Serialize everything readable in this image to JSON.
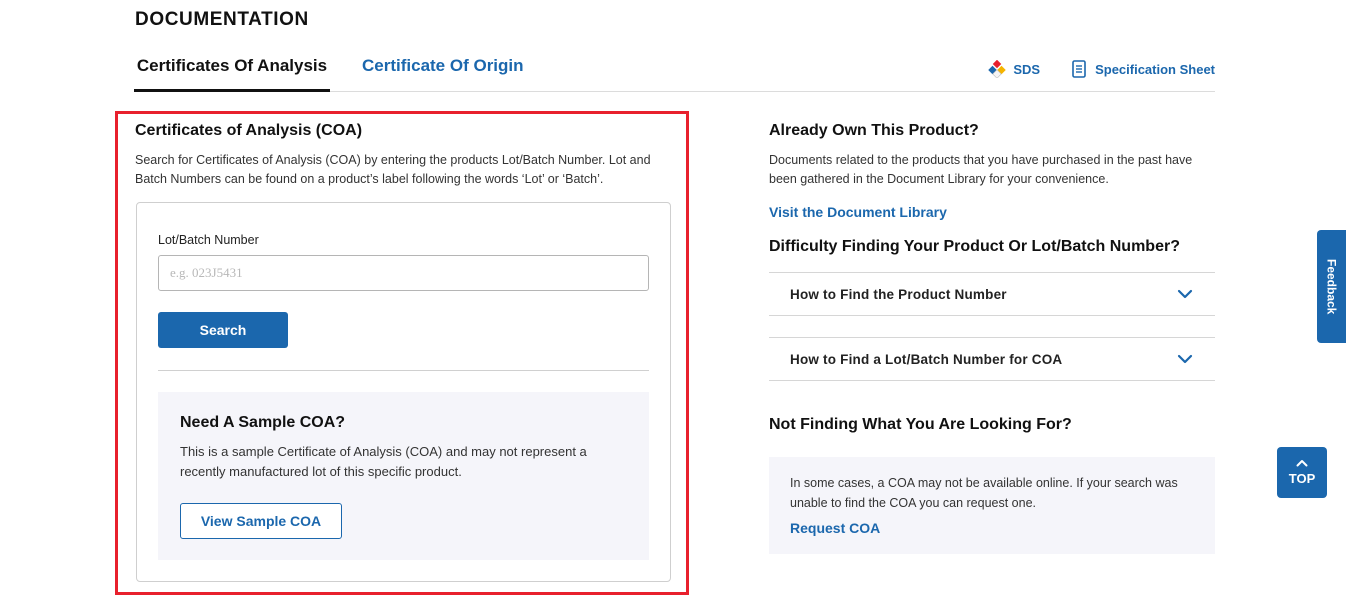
{
  "section": {
    "title": "DOCUMENTATION"
  },
  "tabs": [
    {
      "label": "Certificates Of Analysis",
      "active": true
    },
    {
      "label": "Certificate Of Origin",
      "active": false
    }
  ],
  "doc_links": {
    "sds": {
      "label": "SDS",
      "icon": "diamond-cluster-icon"
    },
    "spec": {
      "label": "Specification Sheet",
      "icon": "document-icon"
    }
  },
  "coa": {
    "heading": "Certificates of Analysis (COA)",
    "description": "Search for Certificates of Analysis (COA) by entering the products Lot/Batch Number. Lot and Batch Numbers can be found on a product’s label following the words ‘Lot’ or ‘Batch’.",
    "lot_label": "Lot/Batch Number",
    "lot_placeholder": "e.g. 023J5431",
    "lot_value": "",
    "search_label": "Search",
    "sample": {
      "heading": "Need A Sample COA?",
      "description": "This is a sample Certificate of Analysis (COA) and may not represent a recently manufactured lot of this specific product.",
      "button_label": "View Sample COA"
    }
  },
  "right": {
    "own_heading": "Already Own This Product?",
    "own_description": "Documents related to the products that you have purchased in the past have been gathered in the Document Library for your convenience.",
    "library_link": "Visit the Document Library",
    "difficulty_heading": "Difficulty Finding Your Product Or Lot/Batch Number?",
    "accordions": [
      {
        "label": "How to Find the Product Number"
      },
      {
        "label": "How to Find a Lot/Batch Number for COA"
      }
    ],
    "notfinding_heading": "Not Finding What You Are Looking For?",
    "request_description": "In some cases, a COA may not be available online. If your search was unable to find the COA you can request one.",
    "request_link": "Request COA"
  },
  "feedback": {
    "label": "Feedback"
  },
  "top_button": {
    "label": "TOP"
  },
  "colors": {
    "accent": "#1b67ad",
    "highlight": "#e8202d",
    "panel_bg": "#f5f5fa",
    "sds_red": "#e8202d",
    "sds_yellow": "#f5b400",
    "sds_blue": "#1b67ad"
  }
}
